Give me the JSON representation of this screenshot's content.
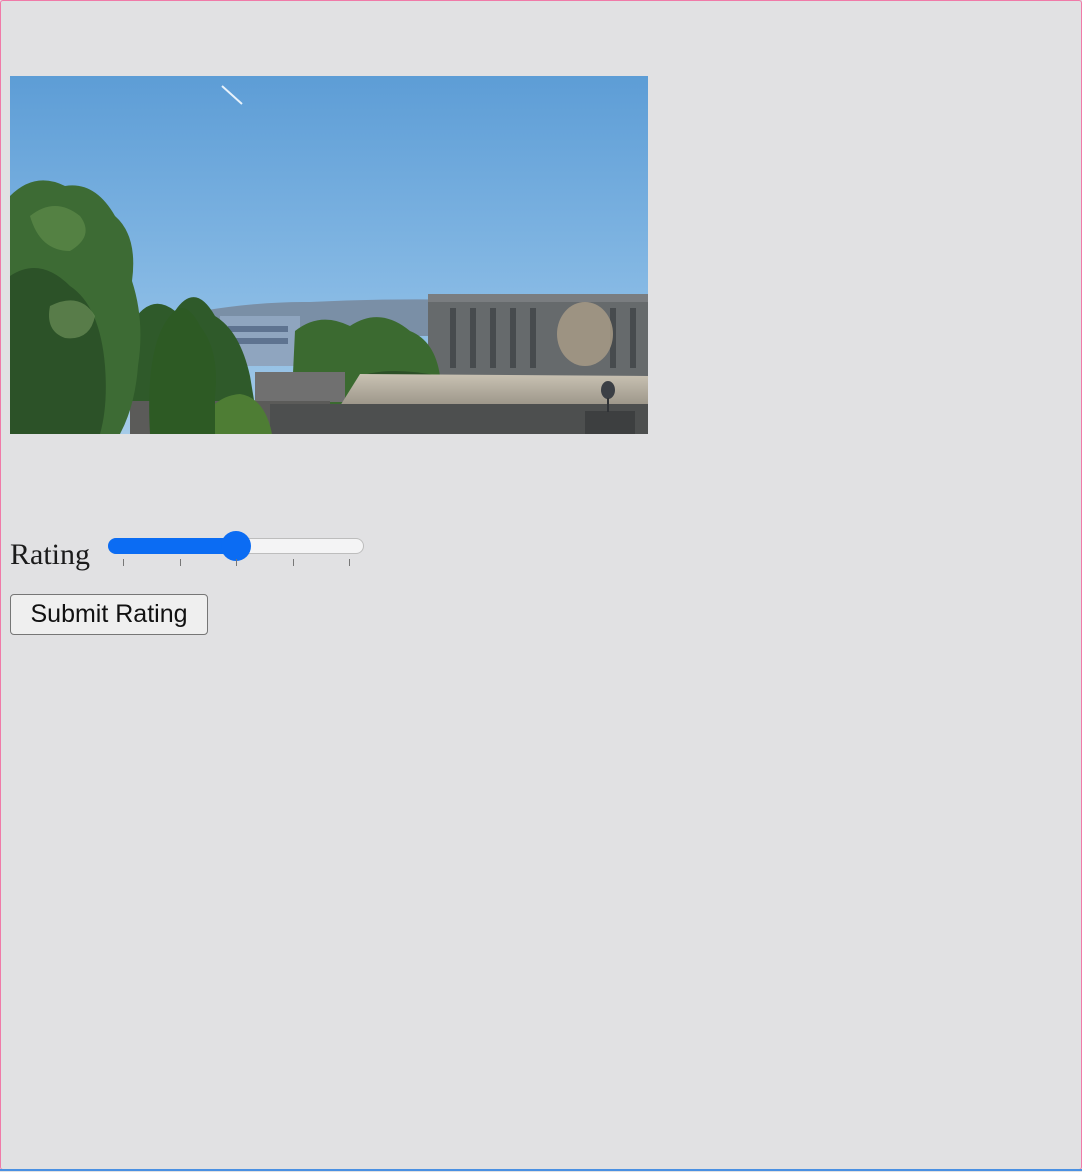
{
  "photo": {
    "subject": "city-rooftops-photo"
  },
  "rating": {
    "label": "Rating",
    "slider": {
      "min": 1,
      "max": 5,
      "value": 3,
      "fraction": 0.5,
      "ticks": [
        1,
        2,
        3,
        4,
        5
      ],
      "accent_color": "#0b6cf3"
    }
  },
  "submit": {
    "label": "Submit Rating"
  },
  "colors": {
    "background": "#e1e1e3",
    "frame_border": "#f07aa8",
    "frame_bottom": "#4a90e2"
  }
}
